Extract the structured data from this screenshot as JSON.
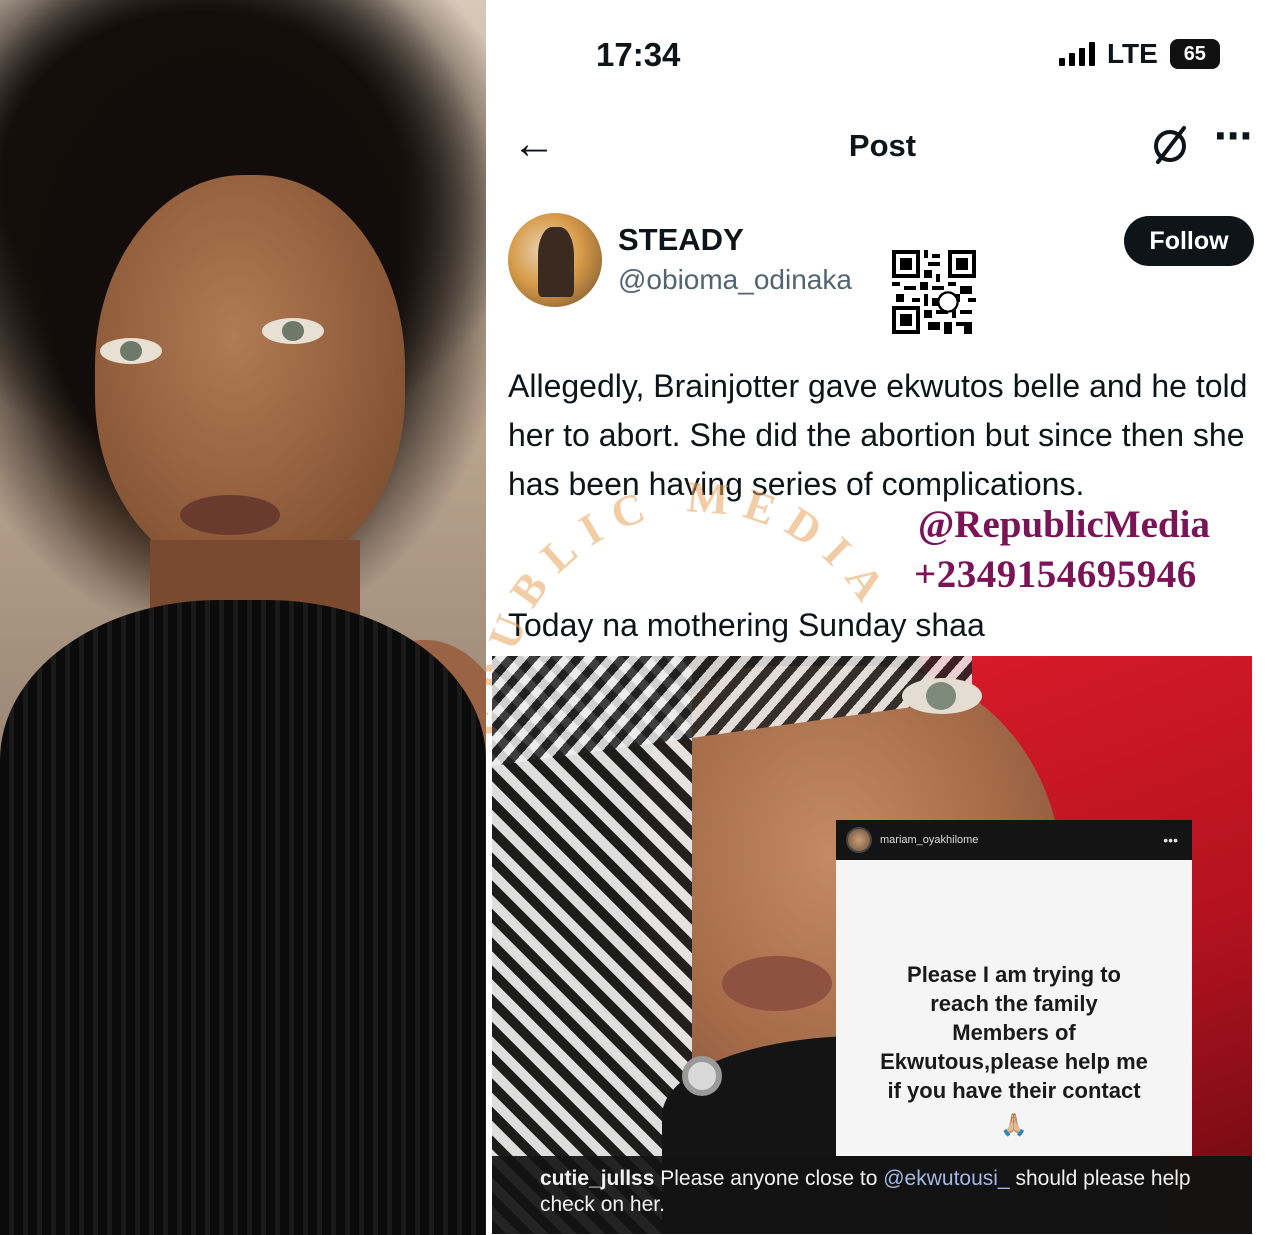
{
  "status_bar": {
    "time": "17:34",
    "network": "LTE",
    "battery": "65"
  },
  "header": {
    "title": "Post",
    "back_icon": "arrow-left-icon",
    "grok_icon": "slash-circle-icon",
    "more_icon": "ellipsis-icon"
  },
  "author": {
    "name": "STEADY",
    "handle": "@obioma_odinaka",
    "follow_label": "Follow"
  },
  "post": {
    "text": "Allegedly, Brainjotter gave ekwutos belle and he told her to abort. She did the abortion but since then she has been having series of complications.",
    "text2": "Today na mothering Sunday shaa"
  },
  "watermark": {
    "handle": "@RepublicMedia",
    "phone": "+2349154695946",
    "arc_text": "REPUBLIC MEDIA",
    "color": "#7a1457"
  },
  "story": {
    "username": "mariam_oyakhilome",
    "more": "•••",
    "body_lines": [
      "Please I am trying to",
      "reach the family",
      "Members of",
      "Ekwutous,please help me",
      "if you have their contact"
    ],
    "emoji": "🙏🏼"
  },
  "caption": {
    "user": "cutie_jullss",
    "text_before": "Please anyone close to",
    "mention": "@ekwutousi_",
    "text_after": "should please help check on her."
  },
  "colors": {
    "follow_bg": "#0f1419",
    "handle_gray": "#536471",
    "media_red": "#d81a2a"
  }
}
